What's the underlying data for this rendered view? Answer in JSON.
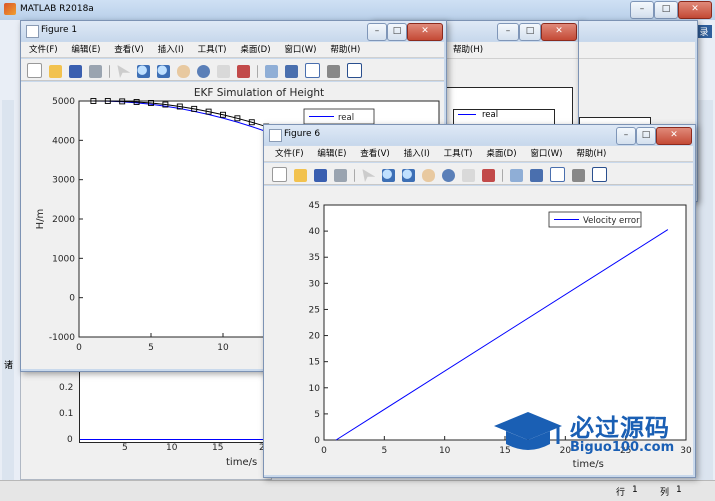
{
  "app": {
    "title": "MATLAB R2018a",
    "side_text": "录",
    "left_char": "诸"
  },
  "status": {
    "row_label": "行",
    "row": "1",
    "col_label": "列",
    "col": "1"
  },
  "menu": [
    "文件(F)",
    "编辑(E)",
    "查看(V)",
    "插入(I)",
    "工具(T)",
    "桌面(D)",
    "窗口(W)",
    "帮助(H)"
  ],
  "back_windows": {
    "menu_help": "帮助(H)",
    "legend_label": "real"
  },
  "figure1": {
    "title": "Figure 1",
    "chart_data": {
      "type": "line",
      "title": "EKF Simulation of Height",
      "xlabel": "time/s",
      "ylabel": "H/m",
      "xlim": [
        0,
        25
      ],
      "ylim": [
        -1000,
        5000
      ],
      "xticks": [
        "0",
        "5",
        "10",
        "15",
        "20"
      ],
      "yticks": [
        "-1000",
        "0",
        "1000",
        "2000",
        "3000",
        "4000",
        "5000"
      ],
      "legend": [
        "real"
      ],
      "series": [
        {
          "name": "real",
          "color": "#0000ff",
          "x": [
            1,
            2,
            3,
            4,
            5,
            6,
            7,
            8,
            9,
            10,
            11,
            12,
            13,
            14,
            15,
            16,
            17,
            18,
            19,
            20,
            20.8
          ],
          "y": [
            5000,
            4996,
            4980,
            4953,
            4916,
            4867,
            4808,
            4737,
            4656,
            4565,
            4462,
            4349,
            4225,
            4091,
            3945,
            3789,
            3623,
            3446,
            3258,
            3060,
            2880
          ]
        },
        {
          "name": "",
          "color": "#000000",
          "marker": "square",
          "x": [
            1,
            2,
            3,
            4,
            5,
            6,
            7,
            8,
            9,
            10,
            11,
            12,
            13,
            14,
            15,
            16,
            17,
            18,
            19,
            20
          ],
          "y": [
            5000,
            5000,
            4990,
            4975,
            4950,
            4910,
            4860,
            4800,
            4730,
            4650,
            4560,
            4460,
            4350,
            4220,
            4090,
            3950,
            3800,
            3640,
            3470,
            3290
          ]
        }
      ]
    }
  },
  "lower_plot": {
    "yticks": [
      "0.2",
      "0.1",
      "0"
    ],
    "xticks": [
      "5",
      "10",
      "15",
      "20"
    ],
    "xlabel": "time/s"
  },
  "figure6": {
    "title": "Figure 6",
    "chart_data": {
      "type": "line",
      "xlabel": "time/s",
      "ylabel": "",
      "xlim": [
        0,
        30
      ],
      "ylim": [
        0,
        45
      ],
      "xticks": [
        "0",
        "5",
        "10",
        "15",
        "20",
        "25",
        "30"
      ],
      "yticks": [
        "0",
        "5",
        "10",
        "15",
        "20",
        "25",
        "30",
        "35",
        "40",
        "45"
      ],
      "legend": [
        "Velocity error"
      ],
      "series": [
        {
          "name": "Velocity error",
          "color": "#0000ff",
          "x": [
            1,
            28.5
          ],
          "y": [
            0,
            40.3
          ]
        }
      ]
    }
  },
  "watermark": {
    "title": "必过源码",
    "url": "Biguo100.com"
  },
  "colors": {
    "accent": "#0000ff",
    "window_frame": "#7d93b4"
  }
}
